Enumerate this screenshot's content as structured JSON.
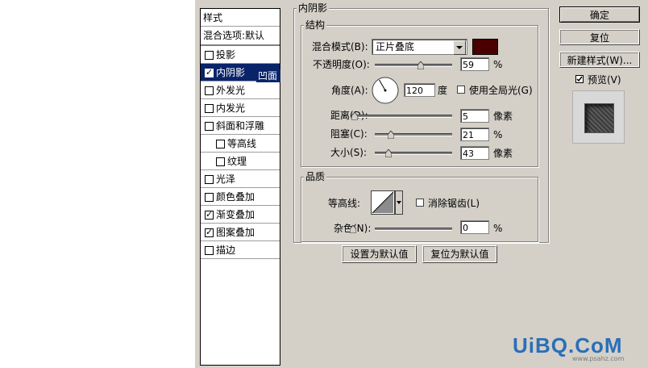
{
  "style_list": {
    "header": "样式",
    "blend_default": "混合选项:默认",
    "items": [
      {
        "label": "投影",
        "checked": false,
        "selected": false,
        "indent": false
      },
      {
        "label": "内阴影",
        "checked": true,
        "selected": true,
        "indent": false
      },
      {
        "label": "外发光",
        "checked": false,
        "selected": false,
        "indent": false
      },
      {
        "label": "内发光",
        "checked": false,
        "selected": false,
        "indent": false
      },
      {
        "label": "斜面和浮雕",
        "checked": false,
        "selected": false,
        "indent": false
      },
      {
        "label": "等高线",
        "checked": false,
        "selected": false,
        "indent": true
      },
      {
        "label": "纹理",
        "checked": false,
        "selected": false,
        "indent": true
      },
      {
        "label": "光泽",
        "checked": false,
        "selected": false,
        "indent": false
      },
      {
        "label": "颜色叠加",
        "checked": false,
        "selected": false,
        "indent": false
      },
      {
        "label": "渐变叠加",
        "checked": true,
        "selected": false,
        "indent": false
      },
      {
        "label": "图案叠加",
        "checked": true,
        "selected": false,
        "indent": false
      },
      {
        "label": "描边",
        "checked": false,
        "selected": false,
        "indent": false
      }
    ],
    "tooltip": "凹面"
  },
  "inner_shadow": {
    "title": "内阴影",
    "structure": {
      "title": "结构",
      "blend_mode_label": "混合模式(B):",
      "blend_mode_value": "正片叠底",
      "color": "#4a0000",
      "opacity_label": "不透明度(O):",
      "opacity_value": "59",
      "opacity_unit": "%",
      "opacity_fraction": 0.59,
      "angle_label": "角度(A):",
      "angle_value": "120",
      "angle_unit": "度",
      "global_light_label": "使用全局光(G)",
      "global_light_checked": false,
      "distance_label": "距离(D):",
      "distance_value": "5",
      "distance_unit": "像素",
      "distance_fraction": 0.02,
      "choke_label": "阻塞(C):",
      "choke_value": "21",
      "choke_unit": "%",
      "choke_fraction": 0.21,
      "size_label": "大小(S):",
      "size_value": "43",
      "size_unit": "像素",
      "size_fraction": 0.172
    },
    "quality": {
      "title": "品质",
      "contour_label": "等高线:",
      "anti_alias_label": "消除锯齿(L)",
      "anti_alias_checked": false,
      "noise_label": "杂色(N):",
      "noise_value": "0",
      "noise_unit": "%",
      "noise_fraction": 0.0
    },
    "set_default_label": "设置为默认值",
    "reset_default_label": "复位为默认值"
  },
  "buttons": {
    "ok": "确定",
    "reset": "复位",
    "new_style": "新建样式(W)...",
    "preview_label": "预览(V)",
    "preview_checked": true
  },
  "watermark": {
    "brand": "UiBQ.CoM",
    "url": "www.psahz.com"
  }
}
